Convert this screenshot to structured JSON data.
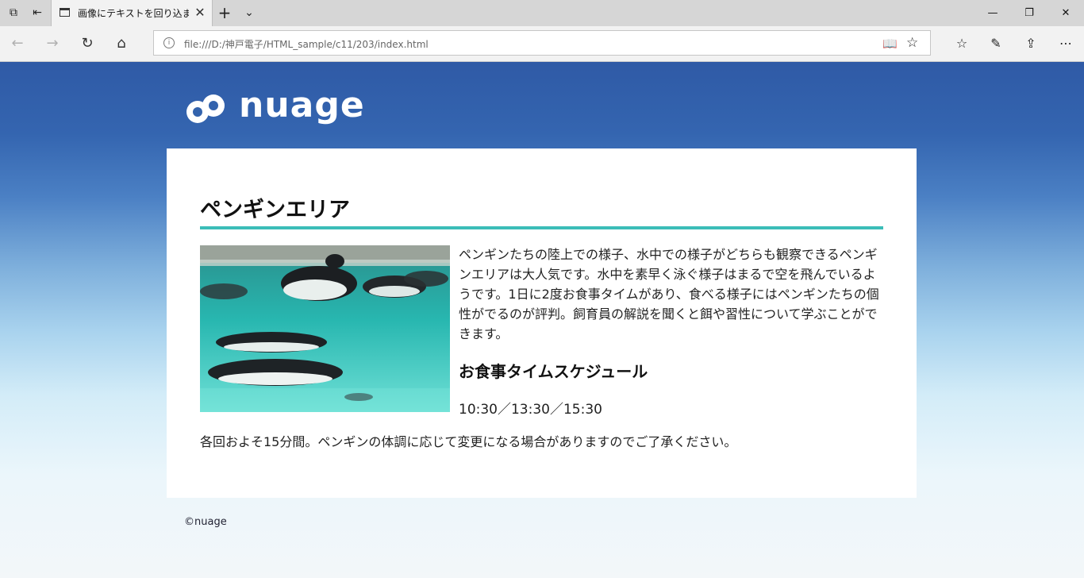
{
  "browser": {
    "tab_title": "画像にテキストを回り込ませ",
    "url": "file:///D:/神戸電子/HTML_sample/c11/203/index.html"
  },
  "page": {
    "logo_text": "nuage",
    "heading": "ペンギンエリア",
    "paragraph": "ペンギンたちの陸上での様子、水中での様子がどちらも観察できるペンギンエリアは大人気です。水中を素早く泳ぐ様子はまるで空を飛んでいるようです。1日に2度お食事タイムがあり、食べる様子にはペンギンたちの個性がでるのが評判。飼育員の解説を聞くと餌や習性について学ぶことができます。",
    "subheading": "お食事タイムスケジュール",
    "times": "10:30／13:30／15:30",
    "note": "各回およそ15分間。ペンギンの体調に応じて変更になる場合がありますのでご了承ください。",
    "copyright": "©nuage"
  },
  "colors": {
    "accent_rule": "#3bbdb8",
    "sky_top": "#2f5aa6",
    "sky_bottom": "#f3f7f9"
  }
}
